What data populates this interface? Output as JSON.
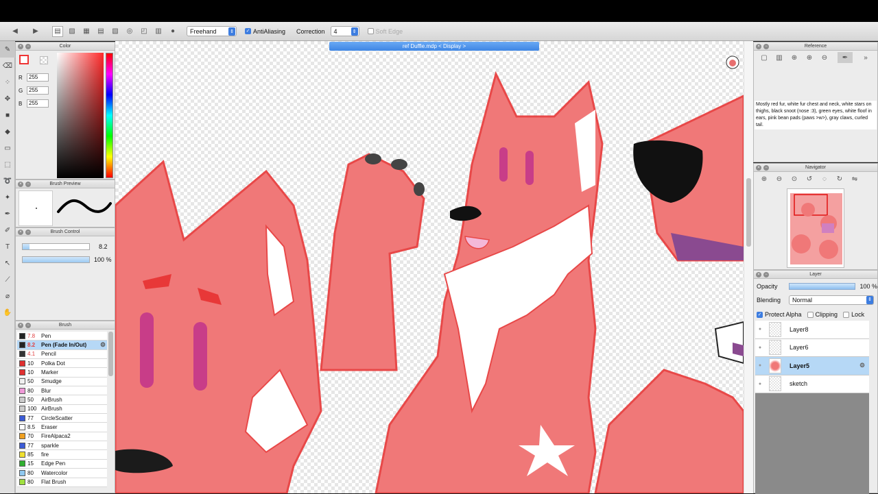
{
  "toolbar": {
    "mode_select": "Freehand",
    "antialiasing_label": "AntiAliasing",
    "antialiasing_checked": true,
    "correction_label": "Correction",
    "correction_value": "4",
    "soft_edge_label": "Soft Edge",
    "soft_edge_checked": false
  },
  "document_tab": "ref Duffle.mdp < Display >",
  "color_panel": {
    "title": "Color",
    "r_label": "R",
    "r_value": "255",
    "g_label": "G",
    "g_value": "255",
    "b_label": "B",
    "b_value": "255",
    "primary_color": "#ffffff",
    "accent_color": "#e33333"
  },
  "brush_preview": {
    "title": "Brush Preview"
  },
  "brush_control": {
    "title": "Brush Control",
    "size_value": "8.2",
    "opacity_value": "100 %",
    "size_fraction": 0.1,
    "opacity_fraction": 1.0
  },
  "brush_panel": {
    "title": "Brush",
    "items": [
      {
        "size": "7.8",
        "name": "Pen",
        "color": "#222222",
        "selected": false
      },
      {
        "size": "8.2",
        "name": "Pen (Fade In/Out)",
        "color": "#222222",
        "selected": true
      },
      {
        "size": "4.1",
        "name": "Pencil",
        "color": "#333333",
        "selected": false
      },
      {
        "size": "10",
        "name": "Polka Dot",
        "color": "#e03030",
        "selected": false
      },
      {
        "size": "10",
        "name": "Marker",
        "color": "#e03030",
        "selected": false
      },
      {
        "size": "50",
        "name": "Smudge",
        "color": "#f0f0f0",
        "selected": false
      },
      {
        "size": "80",
        "name": "Blur",
        "color": "#f09ad8",
        "selected": false
      },
      {
        "size": "50",
        "name": "AirBrush",
        "color": "#cccccc",
        "selected": false
      },
      {
        "size": "100",
        "name": "AirBrush",
        "color": "#cccccc",
        "selected": false
      },
      {
        "size": "77",
        "name": "CircleScatter",
        "color": "#3b5bd6",
        "selected": false
      },
      {
        "size": "8.5",
        "name": "Eraser",
        "color": "#ffffff",
        "selected": false
      },
      {
        "size": "70",
        "name": "FireAlpaca2",
        "color": "#f0a020",
        "selected": false
      },
      {
        "size": "77",
        "name": "sparkle",
        "color": "#3b5bd6",
        "selected": false
      },
      {
        "size": "85",
        "name": "fire",
        "color": "#f0e030",
        "selected": false
      },
      {
        "size": "15",
        "name": "Edge Pen",
        "color": "#30b030",
        "selected": false
      },
      {
        "size": "80",
        "name": "Watercolor",
        "color": "#90c8f0",
        "selected": false
      },
      {
        "size": "80",
        "name": "Flat Brush",
        "color": "#a0e040",
        "selected": false
      }
    ]
  },
  "reference_panel": {
    "title": "Reference",
    "text": "Mostly red fur, white fur chest and neck, white stars on thighs, black snoot (nose :3), green eyes, white floof in ears, pink bean pads (paws >w>), gray claws, curled tail."
  },
  "navigator_panel": {
    "title": "Navigator"
  },
  "layer_panel": {
    "title": "Layer",
    "opacity_label": "Opacity",
    "opacity_value": "100 %",
    "blending_label": "Blending",
    "blending_value": "Normal",
    "protect_alpha_label": "Protect Alpha",
    "protect_alpha_checked": true,
    "clipping_label": "Clipping",
    "lock_label": "Lock",
    "layers": [
      {
        "name": "Layer8",
        "selected": false
      },
      {
        "name": "Layer6",
        "selected": false
      },
      {
        "name": "Layer5",
        "selected": true
      },
      {
        "name": "sketch",
        "selected": false
      }
    ]
  }
}
